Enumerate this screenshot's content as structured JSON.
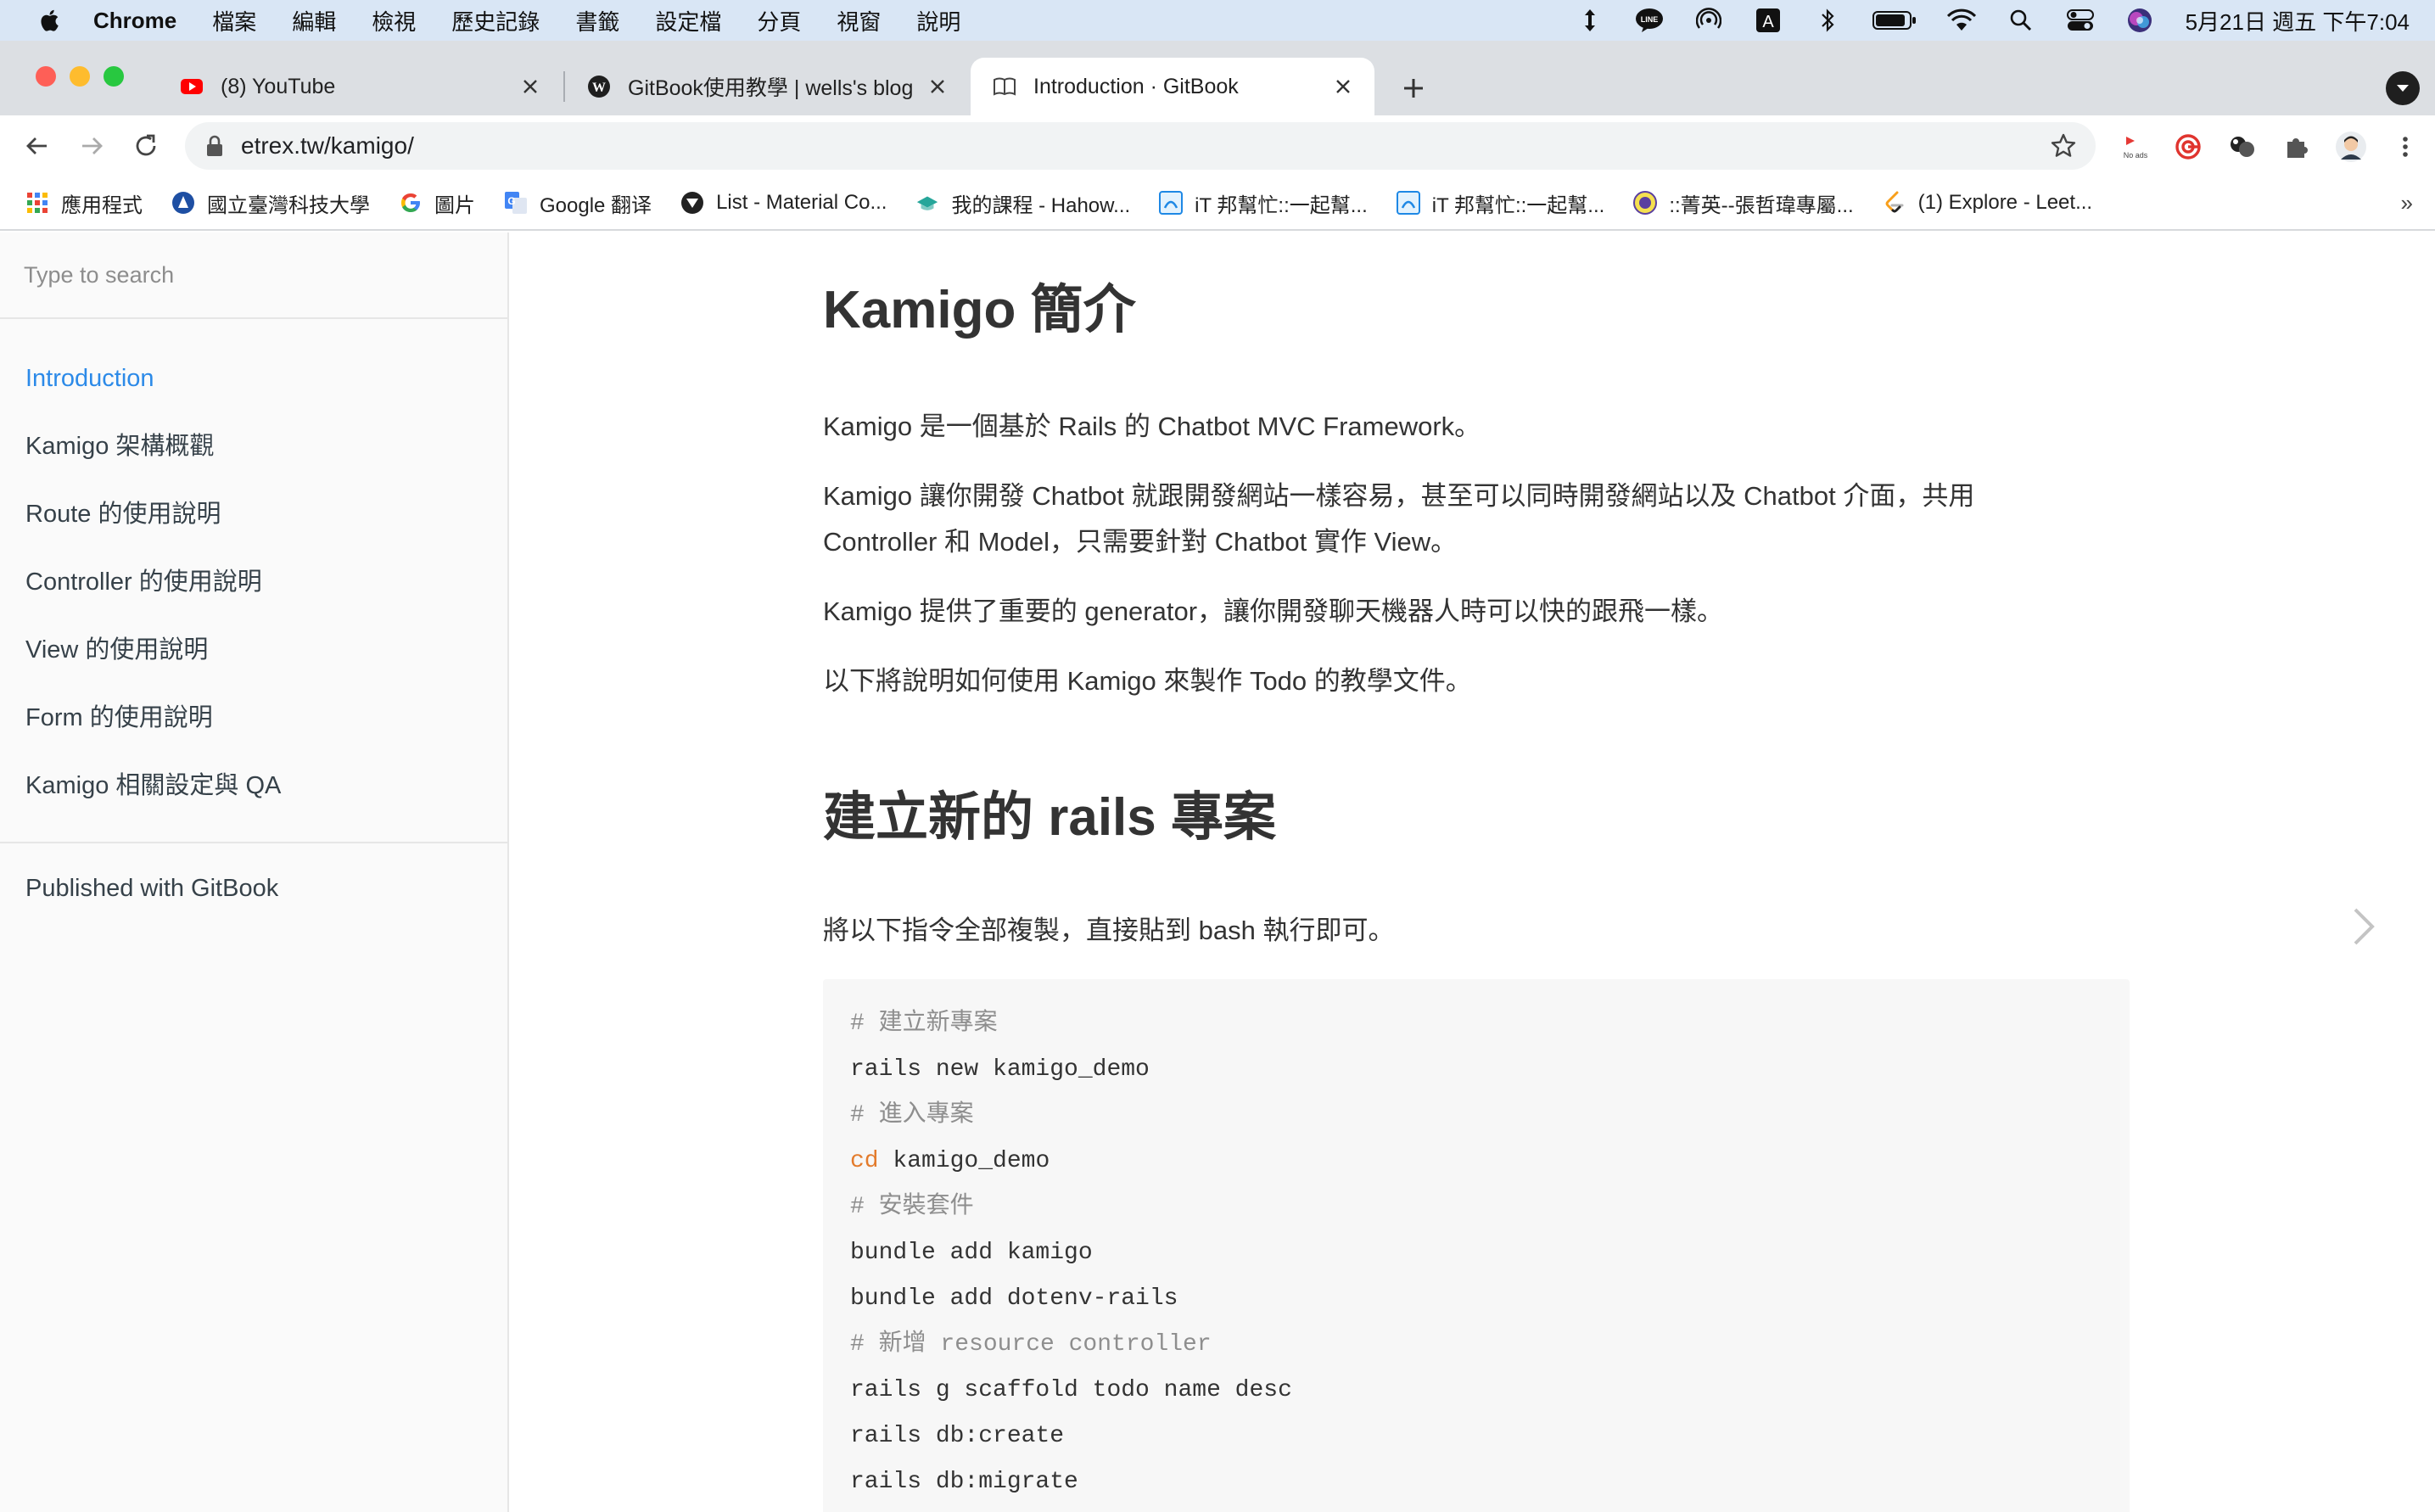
{
  "menubar": {
    "app_name": "Chrome",
    "items": [
      "檔案",
      "編輯",
      "檢視",
      "歷史記錄",
      "書籤",
      "設定檔",
      "分頁",
      "視窗",
      "說明"
    ],
    "status_icons": [
      "arrows-vertical-icon",
      "line-app-icon",
      "airdrop-icon",
      "input-method-icon",
      "bluetooth-icon",
      "battery-icon",
      "wifi-icon",
      "spotlight-search-icon",
      "control-center-icon",
      "siri-icon"
    ],
    "input_method_label": "A",
    "clock": "5月21日 週五 下午7:04"
  },
  "tabs": [
    {
      "title": "(8) YouTube",
      "icon": "youtube-icon",
      "active": false
    },
    {
      "title": "GitBook使用教學 | wells's blog",
      "icon": "wordpress-icon",
      "active": false
    },
    {
      "title": "Introduction · GitBook",
      "icon": "book-icon",
      "active": true
    }
  ],
  "toolbar": {
    "url": "etrex.tw/kamigo/",
    "noads_label": "No ads"
  },
  "bookmarks": [
    {
      "label": "應用程式",
      "icon": "apps-grid-icon"
    },
    {
      "label": "國立臺灣科技大學",
      "icon": "ntust-logo-icon"
    },
    {
      "label": "圖片",
      "icon": "google-icon"
    },
    {
      "label": "Google 翻译",
      "icon": "google-translate-icon"
    },
    {
      "label": "List - Material Co...",
      "icon": "material-icon"
    },
    {
      "label": "我的課程 - Hahow...",
      "icon": "hahow-icon"
    },
    {
      "label": "iT 邦幫忙::一起幫...",
      "icon": "ithelp-icon"
    },
    {
      "label": "iT 邦幫忙::一起幫...",
      "icon": "ithelp-icon"
    },
    {
      "label": "::菁英--張哲瑋專屬...",
      "icon": "elite-icon"
    },
    {
      "label": "(1) Explore - Leet...",
      "icon": "leetcode-icon"
    }
  ],
  "sidebar": {
    "search_placeholder": "Type to search",
    "items": [
      {
        "label": "Introduction",
        "active": true
      },
      {
        "label": "Kamigo 架構概觀",
        "active": false
      },
      {
        "label": "Route 的使用說明",
        "active": false
      },
      {
        "label": "Controller 的使用說明",
        "active": false
      },
      {
        "label": "View 的使用說明",
        "active": false
      },
      {
        "label": "Form 的使用說明",
        "active": false
      },
      {
        "label": "Kamigo 相關設定與 QA",
        "active": false
      }
    ],
    "published": "Published with GitBook"
  },
  "article": {
    "h1_intro": "Kamigo 簡介",
    "p1": "Kamigo 是一個基於 Rails 的 Chatbot MVC Framework。",
    "p2": "Kamigo 讓你開發 Chatbot 就跟開發網站一樣容易，甚至可以同時開發網站以及 Chatbot 介面，共用 Controller 和 Model，只需要針對 Chatbot 實作 View。",
    "p3": "Kamigo 提供了重要的 generator，讓你開發聊天機器人時可以快的跟飛一樣。",
    "p4": "以下將說明如何使用 Kamigo 來製作 Todo 的教學文件。",
    "h1_rails": "建立新的 rails 專案",
    "p5": "將以下指令全部複製，直接貼到 bash 執行即可。",
    "code": {
      "l1": "# 建立新專案",
      "l2": "rails new kamigo_demo",
      "l3": "# 進入專案",
      "l4_kw": "cd",
      "l4_rest": " kamigo_demo",
      "l5": "# 安裝套件",
      "l6": "bundle add kamigo",
      "l7": "bundle add dotenv-rails",
      "l8": "# 新增 resource controller",
      "l9": "rails g scaffold todo name desc",
      "l10": "rails db:create",
      "l11": "rails db:migrate"
    }
  }
}
